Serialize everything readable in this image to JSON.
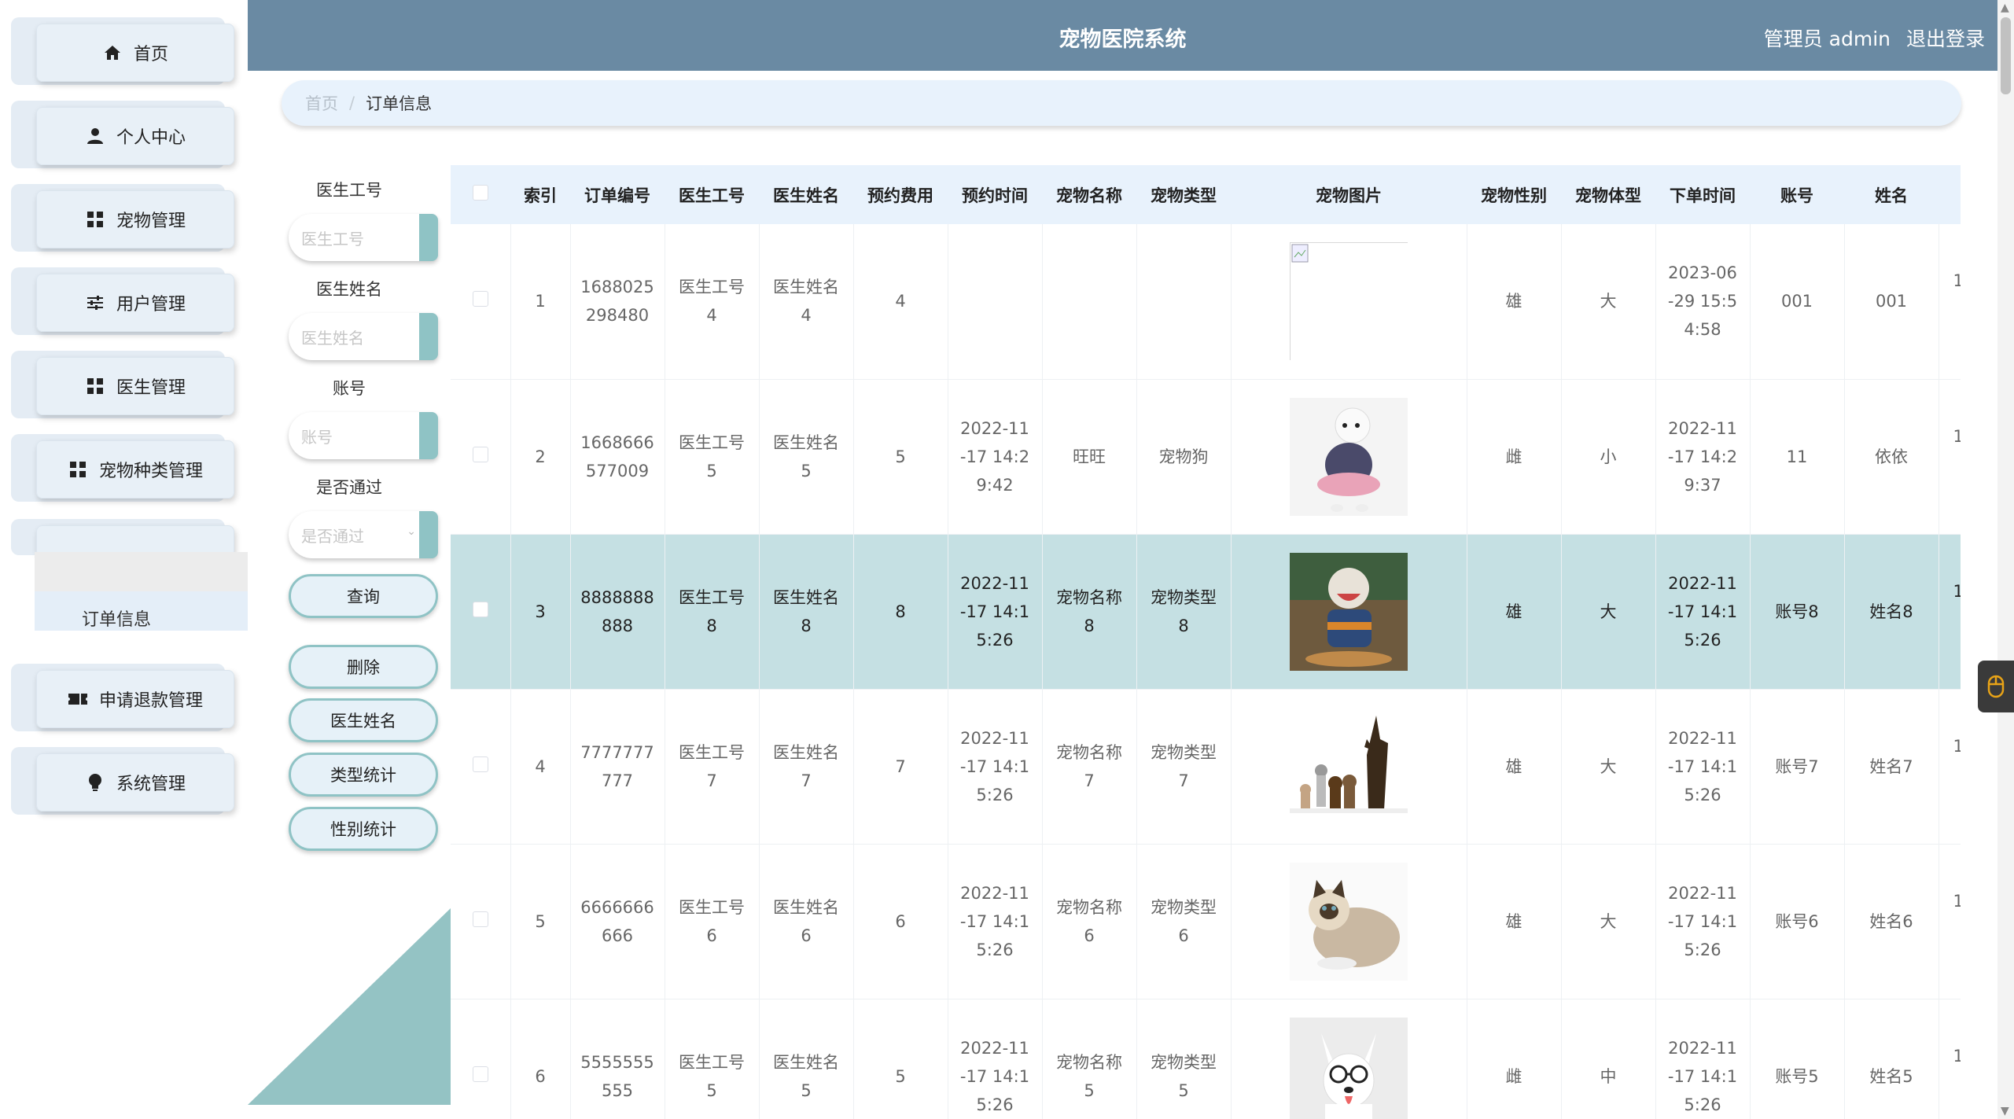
{
  "app": {
    "title": "宠物医院系统",
    "user_label": "管理员 admin",
    "logout": "退出登录"
  },
  "sidebar": {
    "items": [
      {
        "label": "首页",
        "icon": "home-icon"
      },
      {
        "label": "个人中心",
        "icon": "user-icon"
      },
      {
        "label": "宠物管理",
        "icon": "grid-icon"
      },
      {
        "label": "用户管理",
        "icon": "sliders-icon"
      },
      {
        "label": "医生管理",
        "icon": "grid-icon"
      },
      {
        "label": "宠物种类管理",
        "icon": "grid-icon"
      },
      {
        "label": "",
        "icon": ""
      },
      {
        "label": "申请退款管理",
        "icon": "ticket-icon"
      },
      {
        "label": "系统管理",
        "icon": "bulb-icon"
      }
    ],
    "submenu_active": "订单信息"
  },
  "breadcrumb": {
    "home": "首页",
    "separator": "/",
    "current": "订单信息"
  },
  "search": {
    "fields": [
      {
        "label": "医生工号",
        "placeholder": "医生工号"
      },
      {
        "label": "医生姓名",
        "placeholder": "医生姓名"
      },
      {
        "label": "账号",
        "placeholder": "账号"
      },
      {
        "label": "是否通过",
        "placeholder": "是否通过"
      }
    ],
    "buttons": {
      "query": "查询",
      "delete": "删除",
      "doctor_name": "医生姓名",
      "type_stats": "类型统计",
      "gender_stats": "性别统计"
    }
  },
  "table": {
    "columns": [
      "索引",
      "订单编号",
      "医生工号",
      "医生姓名",
      "预约费用",
      "预约时间",
      "宠物名称",
      "宠物类型",
      "宠物图片",
      "宠物性别",
      "宠物体型",
      "下单时间",
      "账号",
      "姓名"
    ],
    "rows": [
      {
        "index": "1",
        "order_no": "1688025298480",
        "doctor_id": "医生工号4",
        "doctor_name": "医生姓名4",
        "fee": "4",
        "appoint_time": "",
        "pet_name": "",
        "pet_type": "",
        "pet_image": "broken",
        "gender": "雄",
        "size": "大",
        "order_time": "2023-06-29 15:54:58",
        "account": "001",
        "name": "001",
        "extra": "1",
        "highlight": false
      },
      {
        "index": "2",
        "order_no": "1668666577009",
        "doctor_id": "医生工号5",
        "doctor_name": "医生姓名5",
        "fee": "5",
        "appoint_time": "2022-11-17 14:29:42",
        "pet_name": "旺旺",
        "pet_type": "宠物狗",
        "pet_image": "dog-white-dress",
        "gender": "雌",
        "size": "小",
        "order_time": "2022-11-17 14:29:37",
        "account": "11",
        "name": "依依",
        "extra": "1",
        "highlight": false
      },
      {
        "index": "3",
        "order_no": "8888888888",
        "doctor_id": "医生工号8",
        "doctor_name": "医生姓名8",
        "fee": "8",
        "appoint_time": "2022-11-17 14:15:26",
        "pet_name": "宠物名称8",
        "pet_type": "宠物类型8",
        "pet_image": "dog-sweater",
        "gender": "雄",
        "size": "大",
        "order_time": "2022-11-17 14:15:26",
        "account": "账号8",
        "name": "姓名8",
        "extra": "1",
        "highlight": true
      },
      {
        "index": "4",
        "order_no": "7777777777",
        "doctor_id": "医生工号7",
        "doctor_name": "医生姓名7",
        "fee": "7",
        "appoint_time": "2022-11-17 14:15:26",
        "pet_name": "宠物名称7",
        "pet_type": "宠物类型7",
        "pet_image": "dogs-group",
        "gender": "雄",
        "size": "大",
        "order_time": "2022-11-17 14:15:26",
        "account": "账号7",
        "name": "姓名7",
        "extra": "1",
        "highlight": false
      },
      {
        "index": "5",
        "order_no": "6666666666",
        "doctor_id": "医生工号6",
        "doctor_name": "医生姓名6",
        "fee": "6",
        "appoint_time": "2022-11-17 14:15:26",
        "pet_name": "宠物名称6",
        "pet_type": "宠物类型6",
        "pet_image": "cat-ragdoll",
        "gender": "雄",
        "size": "大",
        "order_time": "2022-11-17 14:15:26",
        "account": "账号6",
        "name": "姓名6",
        "extra": "1",
        "highlight": false
      },
      {
        "index": "6",
        "order_no": "5555555555",
        "doctor_id": "医生工号5",
        "doctor_name": "医生姓名5",
        "fee": "5",
        "appoint_time": "2022-11-17 14:15:26",
        "pet_name": "宠物名称5",
        "pet_type": "宠物类型5",
        "pet_image": "dog-glasses",
        "gender": "雌",
        "size": "中",
        "order_time": "2022-11-17 14:15:26",
        "account": "账号5",
        "name": "姓名5",
        "extra": "1",
        "highlight": false
      }
    ]
  },
  "colors": {
    "header_bg": "#6a8aa3",
    "accent_teal": "#8fc3c5",
    "row_highlight": "#c5e0e3",
    "table_header_bg": "#e8f2fc"
  }
}
